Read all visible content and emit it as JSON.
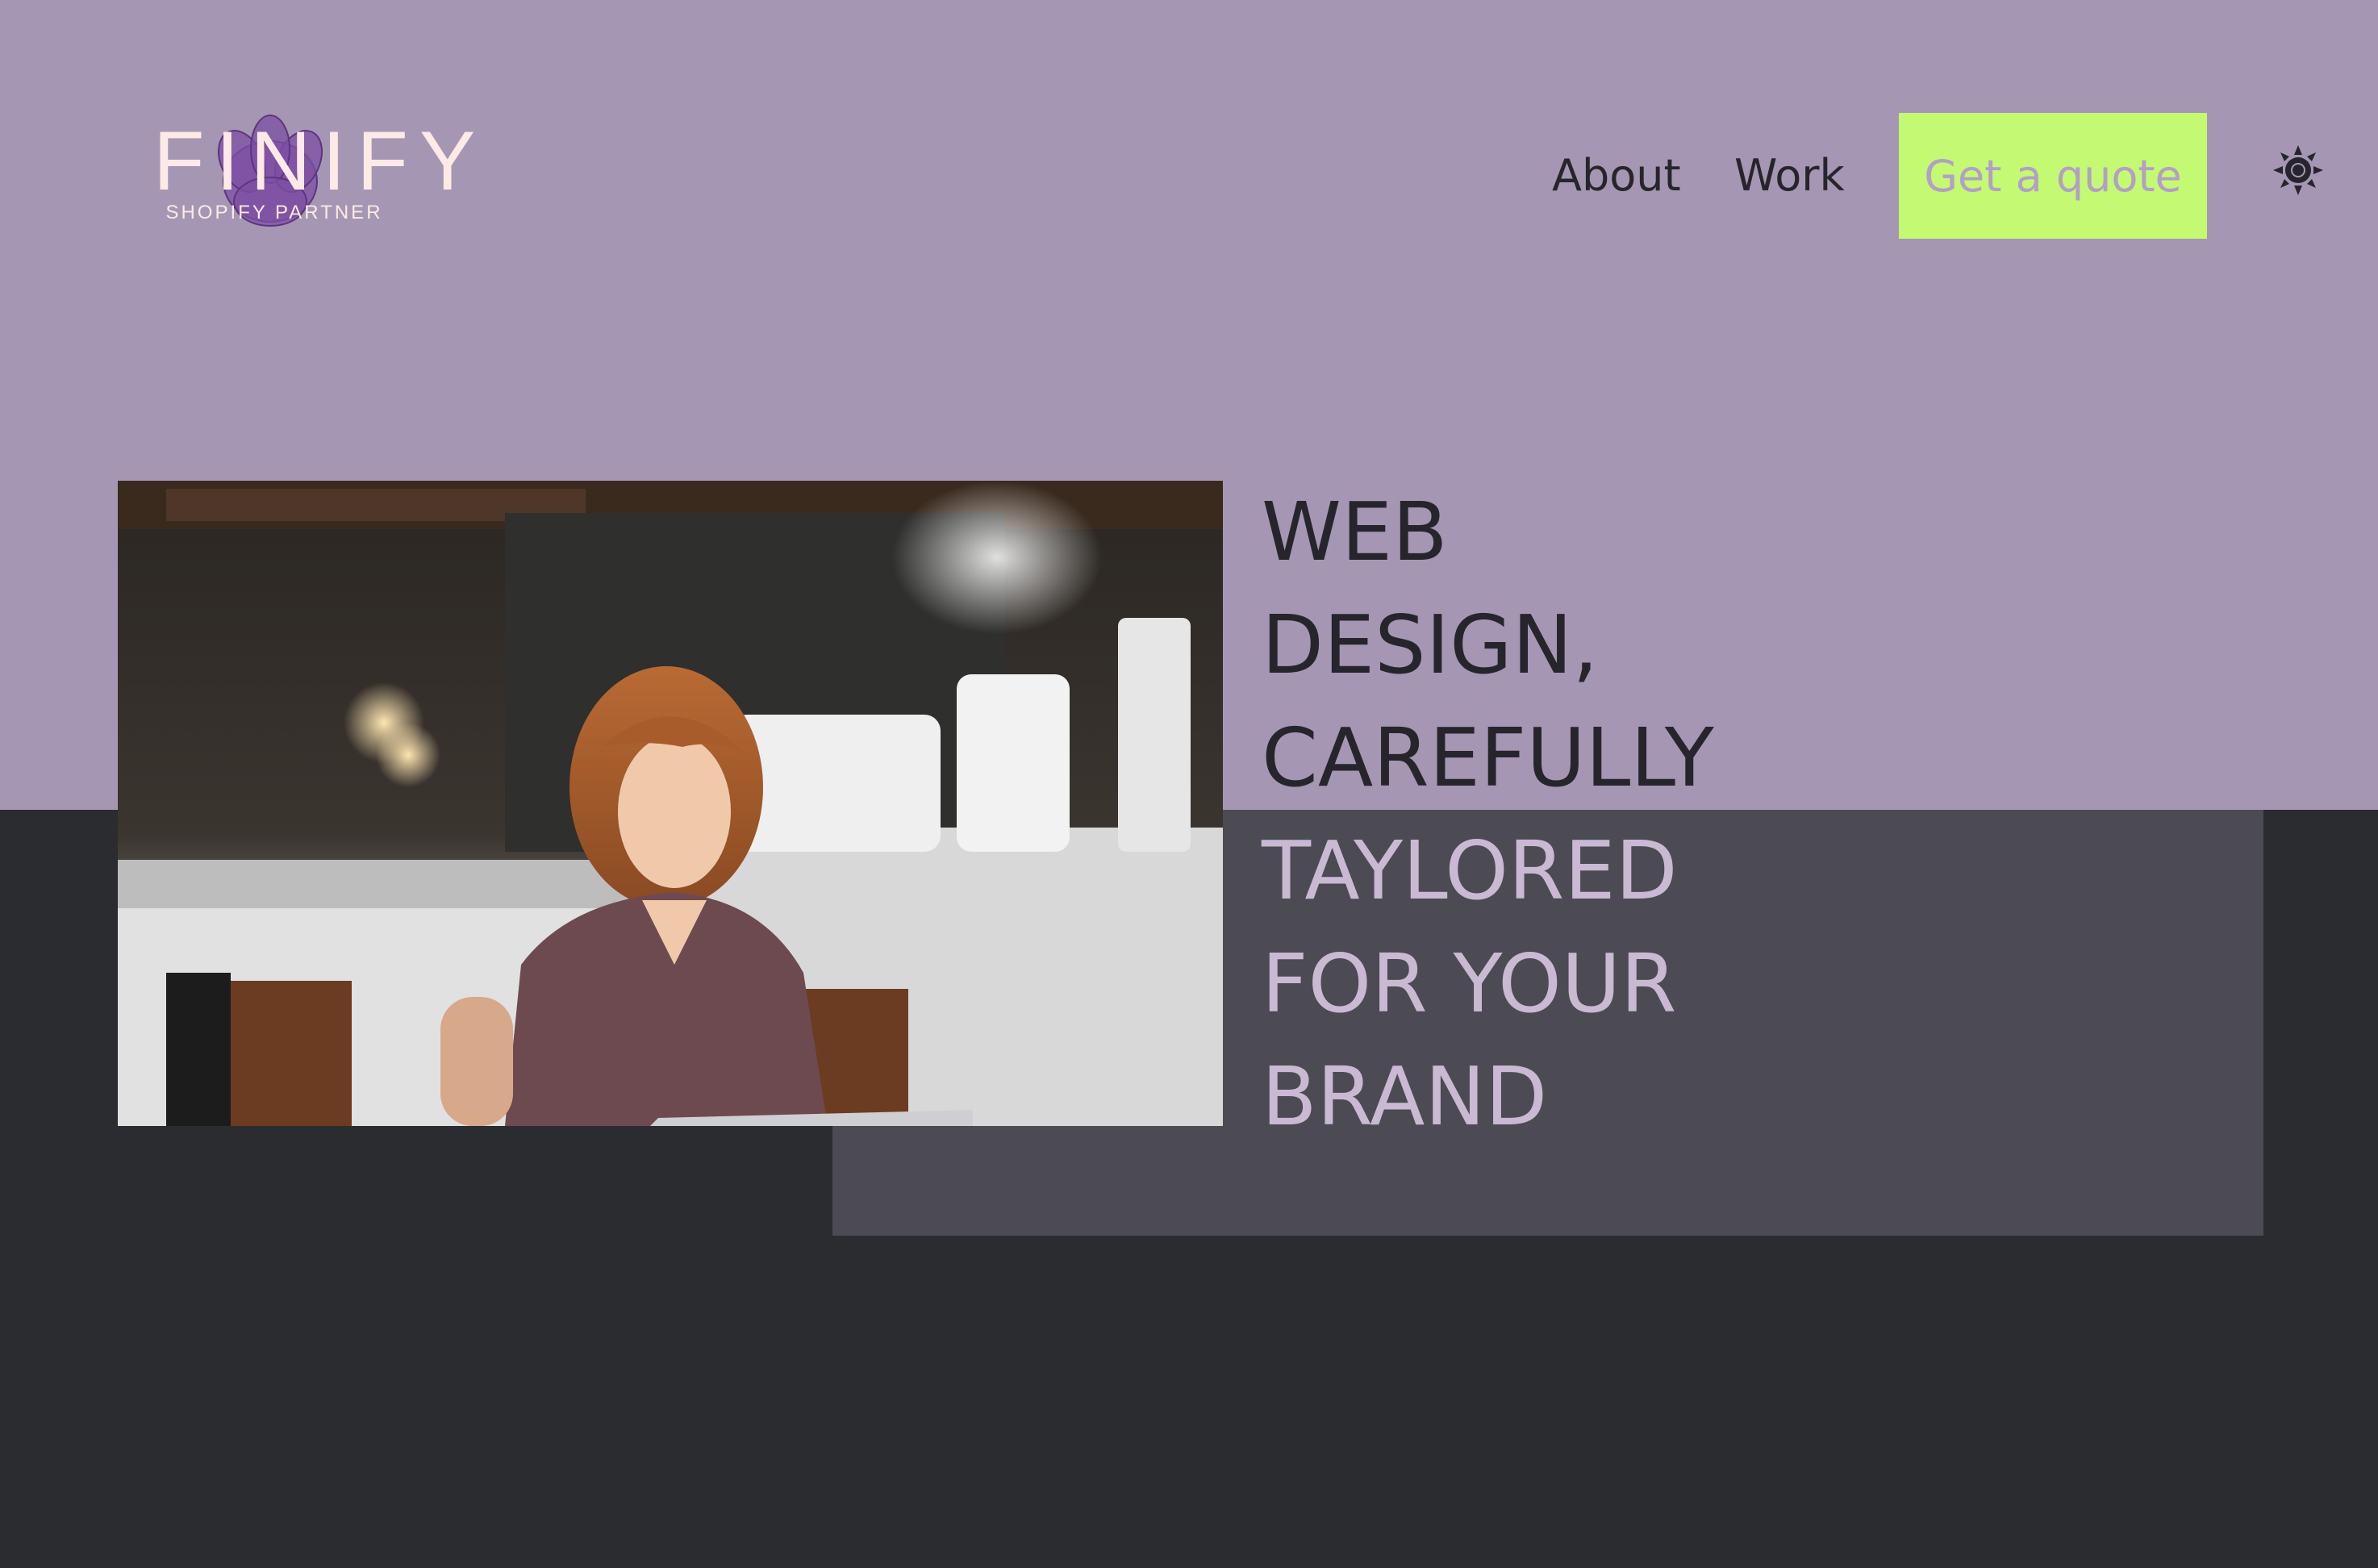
{
  "brand": {
    "logo_word": "FINIFY",
    "logo_sub": "SHOPIFY PARTNER"
  },
  "nav": {
    "about": "About",
    "work": "Work",
    "quote_button": "Get a quote"
  },
  "theme_toggle_icon": "sun-icon",
  "hero": {
    "headline_lines": [
      "WEB",
      "DESIGN,",
      "CAREFULLY",
      "TAYLORED",
      "FOR YOUR",
      "BRAND"
    ],
    "photo_alt": "woman-with-laptop-in-cafe"
  },
  "colors": {
    "top_background": "#a597b3",
    "bottom_background": "#2b2c2f",
    "panel": "#4c4a53",
    "cta_background": "#c4f972",
    "cta_text": "#b39fc7",
    "headline_dark": "#27252c",
    "headline_light": "#c9b9d3",
    "logo": "#fde9e6"
  }
}
